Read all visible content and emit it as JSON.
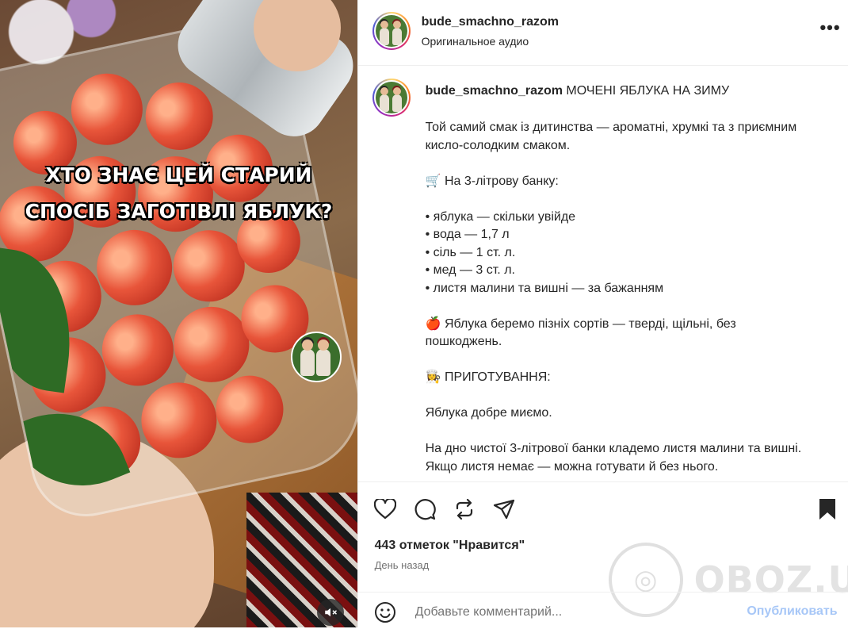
{
  "media": {
    "overlay_line1": "ХТО ЗНАЄ ЦЕЙ СТАРИЙ",
    "overlay_line2": "СПОСІБ ЗАГОТІВЛІ ЯБЛУК?",
    "mute_icon": "speaker-muted-icon"
  },
  "header": {
    "username": "bude_smachno_razom",
    "audio": "Оригинальное аудио",
    "more_icon": "more-horizontal-icon"
  },
  "caption": {
    "username": "bude_smachno_razom",
    "title": "МОЧЕНІ ЯБЛУКА НА ЗИМУ",
    "lines": [
      "Той самий смак із дитинства — ароматні, хрумкі та з приємним кисло-солодким смаком.",
      "",
      "🛒 На 3-літрову банку:",
      "",
      "• яблука — скільки увійде",
      "• вода — 1,7 л",
      "• сіль — 1 ст. л.",
      "• мед — 3 ст. л.",
      "• листя малини та вишні — за бажанням",
      "",
      "🍎 Яблука беремо пізніх сортів — тверді, щільні, без пошкоджень.",
      "",
      "👩‍🍳 ПРИГОТУВАННЯ:",
      "",
      "Яблука добре миємо.",
      "",
      "На дно чистої 3-літрової банки кладемо листя малини та вишні. Якщо листя немає — можна готувати й без нього."
    ]
  },
  "actions": {
    "icons": [
      "heart-icon",
      "comment-icon",
      "repost-icon",
      "share-icon",
      "bookmark-icon"
    ],
    "likes": "443 отметок \"Нравится\"",
    "time": "День назад"
  },
  "comment": {
    "placeholder": "Добавьте комментарий...",
    "publish": "Опубликовать"
  },
  "watermark": {
    "text": "OBOZ.UA"
  },
  "colors": {
    "publish": "#a7c7f7",
    "secondary_text": "#737373",
    "divider": "#efefef"
  }
}
